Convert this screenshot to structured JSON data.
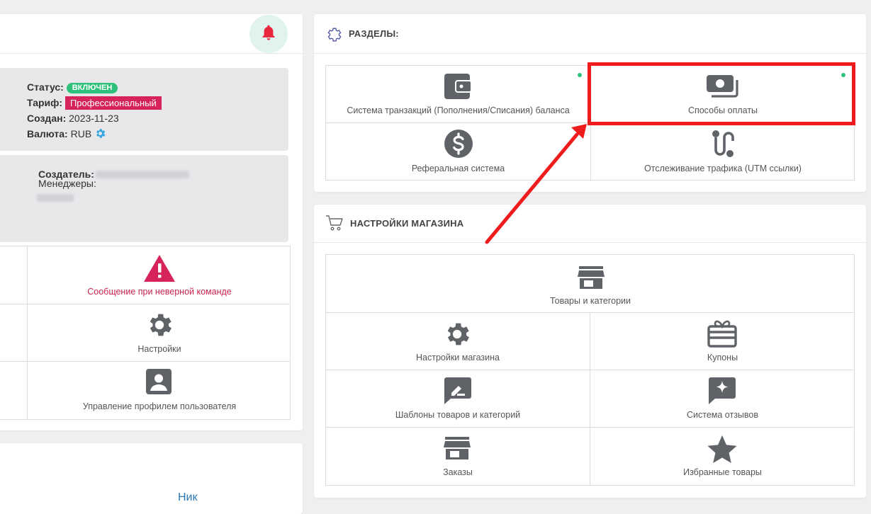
{
  "left_panel": {
    "status_label": "Статус:",
    "status_value": "ВКЛЮЧЕН",
    "tariff_label": "Тариф:",
    "tariff_value": "Профессиональный",
    "created_label": "Создан:",
    "created_value": "2023-11-23",
    "currency_label": "Валюта:",
    "currency_value": "RUB",
    "creator_label": "Создатель:",
    "managers_label": "Менеджеры:",
    "menu": [
      {
        "label": "Сообщение при неверной команде",
        "icon": "warning-icon"
      },
      {
        "label": "Настройки",
        "icon": "gear-icon"
      },
      {
        "label": "Управление профилем пользователя",
        "icon": "user-profile-icon"
      }
    ],
    "link_text": "Ник"
  },
  "sections": {
    "title": "РАЗДЕЛЫ:",
    "items": [
      {
        "label": "Система транзакций (Пополнения/Списания) баланса",
        "icon": "wallet-icon"
      },
      {
        "label": "Способы оплаты",
        "icon": "payment-methods-icon"
      },
      {
        "label": "Реферальная система",
        "icon": "dollar-circle-icon"
      },
      {
        "label": "Отслеживание трафика (UTM ссылки)",
        "icon": "route-icon"
      }
    ]
  },
  "shop": {
    "title": "НАСТРОЙКИ МАГАЗИНА",
    "items": [
      {
        "label": "Товары и категории",
        "icon": "store-icon"
      },
      {
        "label": "Настройки магазина",
        "icon": "gear-icon"
      },
      {
        "label": "Купоны",
        "icon": "coupon-icon"
      },
      {
        "label": "Шаблоны товаров и категорий",
        "icon": "template-icon"
      },
      {
        "label": "Система отзывов",
        "icon": "review-icon"
      },
      {
        "label": "Заказы",
        "icon": "store-icon"
      },
      {
        "label": "Избранные товары",
        "icon": "star-icon"
      }
    ]
  },
  "colors": {
    "accent_green": "#2fc07a",
    "badge_red": "#d6235a",
    "highlight_red": "#ee1c1c",
    "icon_gray": "#5f6368",
    "link_blue": "#2a7ab8"
  }
}
